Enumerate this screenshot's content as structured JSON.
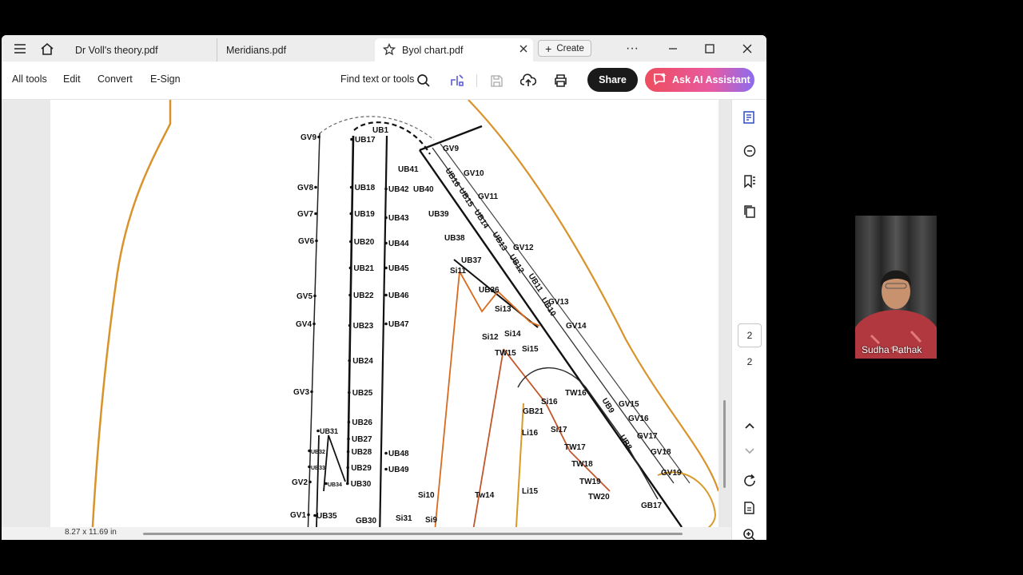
{
  "tabs": [
    {
      "label": "Dr Voll's theory.pdf"
    },
    {
      "label": "Meridians.pdf"
    },
    {
      "label": "Byol chart.pdf",
      "active": true
    }
  ],
  "tabbar": {
    "create_label": "Create",
    "more_label": "···"
  },
  "toolbar": {
    "menu": [
      "All tools",
      "Edit",
      "Convert",
      "E-Sign"
    ],
    "find_label": "Find text or tools",
    "share_label": "Share",
    "ai_label": "Ask AI Assistant"
  },
  "page_indicator": {
    "current": "2",
    "total": "2"
  },
  "status": {
    "page_size": "8.27 x 11.69 in"
  },
  "video": {
    "participant": "Sudha Pathak"
  },
  "chart_labels": {
    "gv": [
      "GV9",
      "GV8",
      "GV7",
      "GV6",
      "GV5",
      "GV4",
      "GV3",
      "GV2",
      "GV1"
    ],
    "ub_inner": [
      "UB17",
      "UB18",
      "UB19",
      "UB20",
      "UB21",
      "UB22",
      "UB23",
      "UB24",
      "UB25",
      "UB26",
      "UB27",
      "UB28",
      "UB29",
      "UB30"
    ],
    "ub_outer": [
      "UB42",
      "UB43",
      "UB44",
      "UB45",
      "UB46",
      "UB47",
      "UB48",
      "UB49"
    ],
    "ub_low": [
      "UB31",
      "UB32",
      "UB33",
      "UB34",
      "UB35"
    ],
    "ub_top": [
      "UB1",
      "UB41",
      "UB40",
      "UB39",
      "UB38",
      "UB37",
      "UB36"
    ],
    "diag_gv": [
      "GV9",
      "GV10",
      "GV11",
      "GV12",
      "GV13",
      "GV14",
      "GV15",
      "GV16",
      "GV17",
      "GV18",
      "GV19"
    ],
    "diag_ub": [
      "UB16",
      "UB15",
      "UB14",
      "UB13",
      "UB12",
      "UB11",
      "UB10",
      "UB9",
      "UB8"
    ],
    "si": [
      "Si11",
      "Si13",
      "Si12",
      "Si14",
      "Si15",
      "Si16",
      "Si17",
      "Si10",
      "Si9",
      "Si31"
    ],
    "tw": [
      "TW15",
      "TW16",
      "TW17",
      "TW18",
      "TW19",
      "TW20",
      "Tw14"
    ],
    "gb": [
      "GB21",
      "GB30",
      "GB17"
    ],
    "li": [
      "Li16",
      "Li15"
    ]
  },
  "colors": {
    "accent_ai": "#ee4d5e",
    "meridian_orange": "#d96b1f",
    "curve_gold": "#d89a2a"
  }
}
